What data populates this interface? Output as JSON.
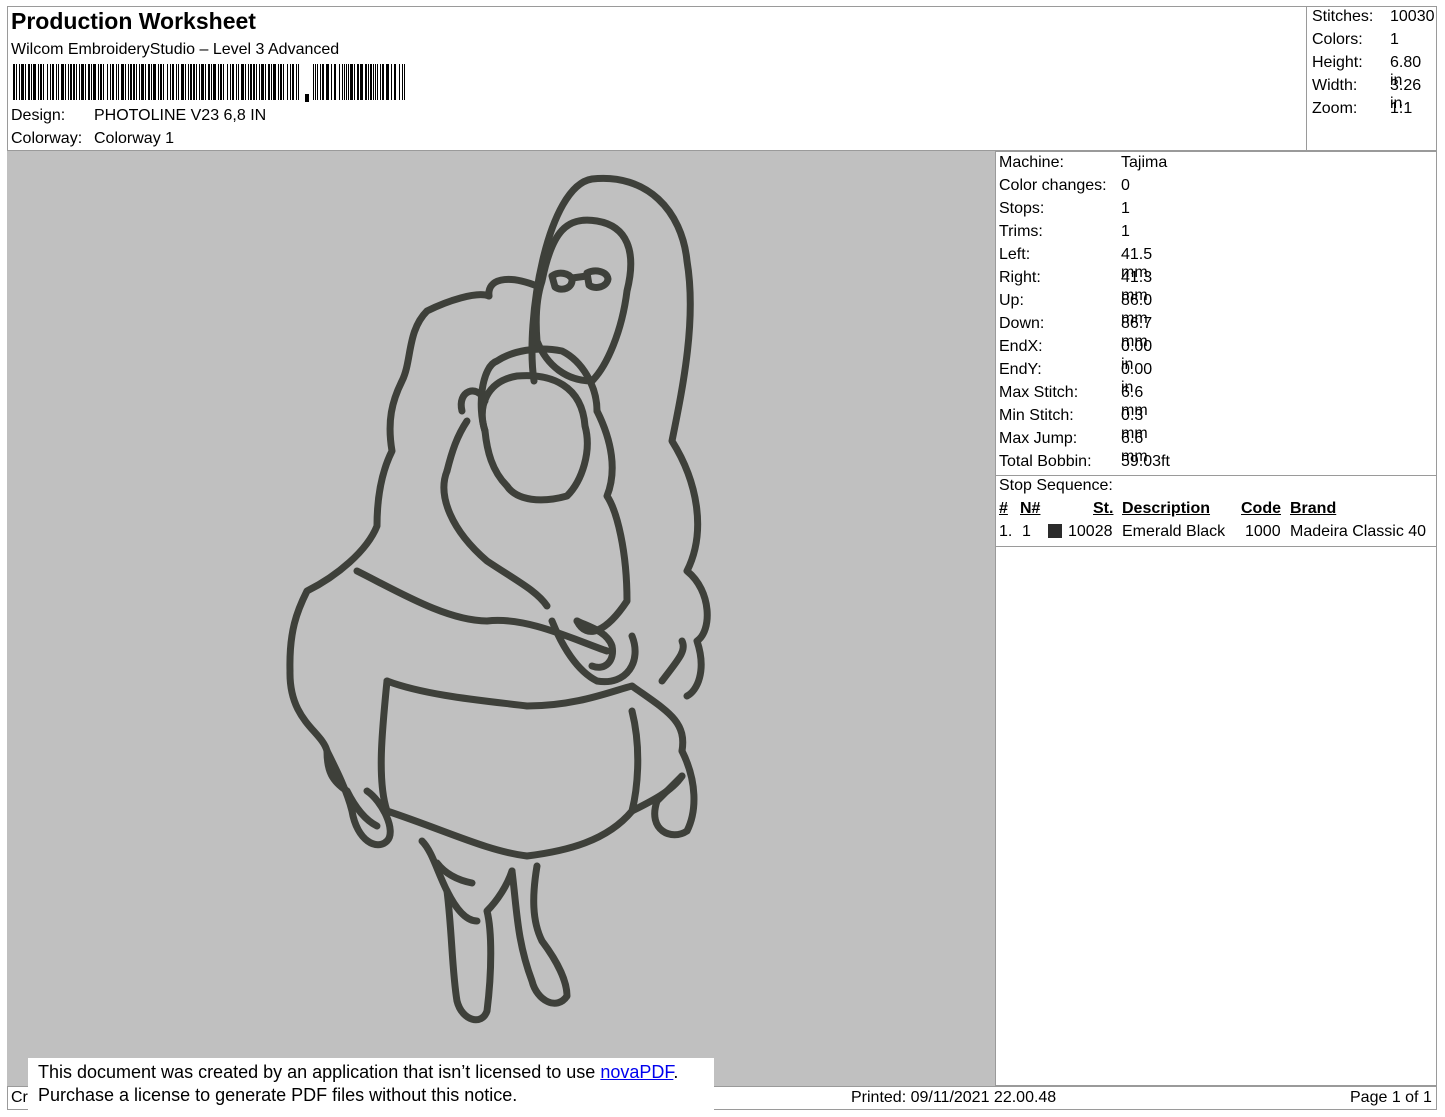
{
  "header": {
    "title": "Production Worksheet",
    "software": "Wilcom EmbroideryStudio – Level 3 Advanced",
    "design_label": "Design:",
    "design_value": "PHOTOLINE V23 6,8 IN",
    "colorway_label": "Colorway:",
    "colorway_value": "Colorway 1"
  },
  "stats": [
    {
      "label": "Stitches:",
      "value": "10030"
    },
    {
      "label": "Colors:",
      "value": "1"
    },
    {
      "label": "Height:",
      "value": "6.80 in"
    },
    {
      "label": "Width:",
      "value": "3.26 in"
    },
    {
      "label": "Zoom:",
      "value": "1:1"
    }
  ],
  "details": [
    {
      "label": "Machine:",
      "value": "Tajima"
    },
    {
      "label": "Color changes:",
      "value": "0"
    },
    {
      "label": "Stops:",
      "value": "1"
    },
    {
      "label": "Trims:",
      "value": "1"
    },
    {
      "label": "Left:",
      "value": "41.5 mm"
    },
    {
      "label": "Right:",
      "value": "41.3 mm"
    },
    {
      "label": "Up:",
      "value": "86.0 mm"
    },
    {
      "label": "Down:",
      "value": "86.7 mm"
    },
    {
      "label": "EndX:",
      "value": "0.00 in"
    },
    {
      "label": "EndY:",
      "value": "0.00 in"
    },
    {
      "label": "Max Stitch:",
      "value": "6.6 mm"
    },
    {
      "label": "Min Stitch:",
      "value": "0.3 mm"
    },
    {
      "label": "Max Jump:",
      "value": "6.6 mm"
    },
    {
      "label": "Total Bobbin:",
      "value": "59.03ft"
    }
  ],
  "stop_sequence": {
    "title": "Stop Sequence:",
    "headers": {
      "num": "#",
      "n": "N#",
      "st": "St.",
      "description": "Description",
      "code": "Code",
      "brand": "Brand"
    },
    "rows": [
      {
        "num": "1.",
        "n": "1",
        "swatch_color": "#2b2b2b",
        "st": "10028",
        "description": "Emerald Black",
        "code": "1000",
        "brand": "Madeira Classic 40"
      }
    ]
  },
  "canvas": {
    "background": "#c0c0c0",
    "stitch_color": "#3e403a"
  },
  "notice": {
    "line1": "This document was created by an application that isn’t licensed to use",
    "link": "novaPDF",
    "line1_end": ".",
    "line2": "Purchase a license to generate PDF files without this notice."
  },
  "footer": {
    "created_fragment": "Cr",
    "printed": "Printed: 09/11/2021 22.00.48",
    "page": "Page 1 of 1"
  }
}
